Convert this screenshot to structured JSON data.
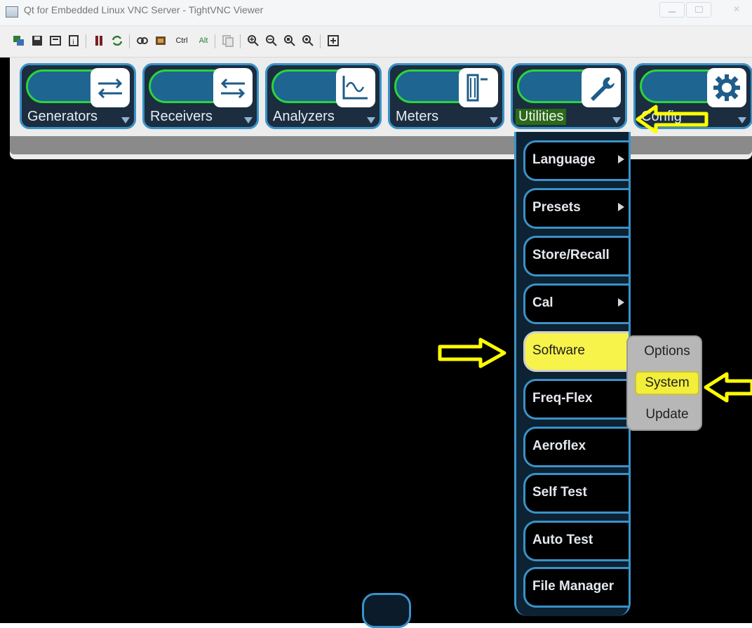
{
  "window": {
    "title": "Qt for Embedded Linux VNC Server - TightVNC Viewer",
    "controls": {
      "close": "✕"
    }
  },
  "toolbar": {
    "ctrl_label": "Ctrl",
    "alt_label": "Alt",
    "icons": [
      "new-connection-icon",
      "save-icon",
      "options-icon",
      "info-icon",
      "pause-icon",
      "refresh-icon",
      "full-screen-icon",
      "tightvnc-icon",
      "copy-icon",
      "zoom-in-icon",
      "zoom-out-icon",
      "zoom-actual-icon",
      "zoom-fit-icon",
      "fit-window-icon"
    ]
  },
  "nav": {
    "items": [
      {
        "label": "Generators",
        "icon": "loop-arrows-icon"
      },
      {
        "label": "Receivers",
        "icon": "reverse-loop-arrows-icon"
      },
      {
        "label": "Analyzers",
        "icon": "waveform-chart-icon"
      },
      {
        "label": "Meters",
        "icon": "meter-icon"
      },
      {
        "label": "Utilities",
        "icon": "wrench-icon",
        "active": true
      },
      {
        "label": "Config",
        "icon": "gear-icon"
      }
    ]
  },
  "utilities_menu": {
    "items": [
      {
        "label": "Language",
        "has_submenu": true
      },
      {
        "label": "Presets",
        "has_submenu": true
      },
      {
        "label": "Store/Recall",
        "has_submenu": false
      },
      {
        "label": "Cal",
        "has_submenu": true
      },
      {
        "label": "Software",
        "has_submenu": true,
        "selected": true
      },
      {
        "label": "Freq-Flex",
        "has_submenu": false
      },
      {
        "label": "Aeroflex",
        "has_submenu": false
      },
      {
        "label": "Self Test",
        "has_submenu": false
      },
      {
        "label": "Auto Test",
        "has_submenu": false
      },
      {
        "label": "File Manager",
        "has_submenu": false
      }
    ]
  },
  "software_submenu": {
    "items": [
      "Options",
      "System",
      "Update"
    ],
    "selected": "System"
  },
  "colors": {
    "accent_blue": "#3a92c8",
    "highlight_yellow": "#f7f34a",
    "annotation_yellow": "#ffff00",
    "active_green": "#2a6a19"
  }
}
